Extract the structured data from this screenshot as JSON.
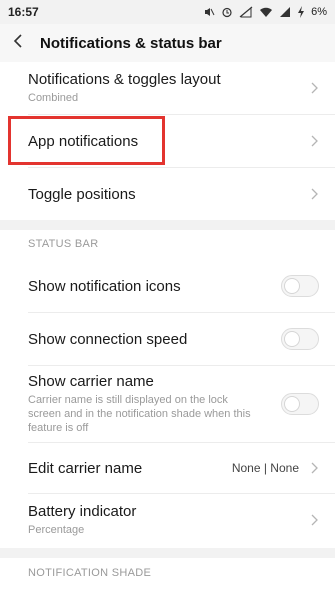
{
  "status_bar": {
    "time": "16:57",
    "battery": "6%",
    "icons": [
      "mute-icon",
      "alarm-icon",
      "signal-off-icon",
      "wifi-icon",
      "cellular-icon",
      "charging-icon"
    ]
  },
  "header": {
    "title": "Notifications & status bar",
    "back_icon": "back-arrow-icon"
  },
  "rows": {
    "layout": {
      "title": "Notifications & toggles layout",
      "subtitle": "Combined"
    },
    "app_notifications": {
      "title": "App notifications"
    },
    "toggle_positions": {
      "title": "Toggle positions"
    },
    "show_notification_icons": {
      "title": "Show notification icons",
      "on": false
    },
    "show_connection_speed": {
      "title": "Show connection speed",
      "on": false
    },
    "show_carrier_name": {
      "title": "Show carrier name",
      "subtitle": "Carrier name is still displayed on the lock screen and in the notification shade when this feature is off",
      "on": false
    },
    "edit_carrier_name": {
      "title": "Edit carrier name",
      "value": "None | None"
    },
    "battery_indicator": {
      "title": "Battery indicator",
      "subtitle": "Percentage"
    }
  },
  "sections": {
    "status_bar": "STATUS BAR",
    "notification_shade": "NOTIFICATION SHADE"
  },
  "colors": {
    "highlight": "#e3342f",
    "section_gap": "#f2f2f2",
    "subtitle": "#9a9a9a"
  }
}
